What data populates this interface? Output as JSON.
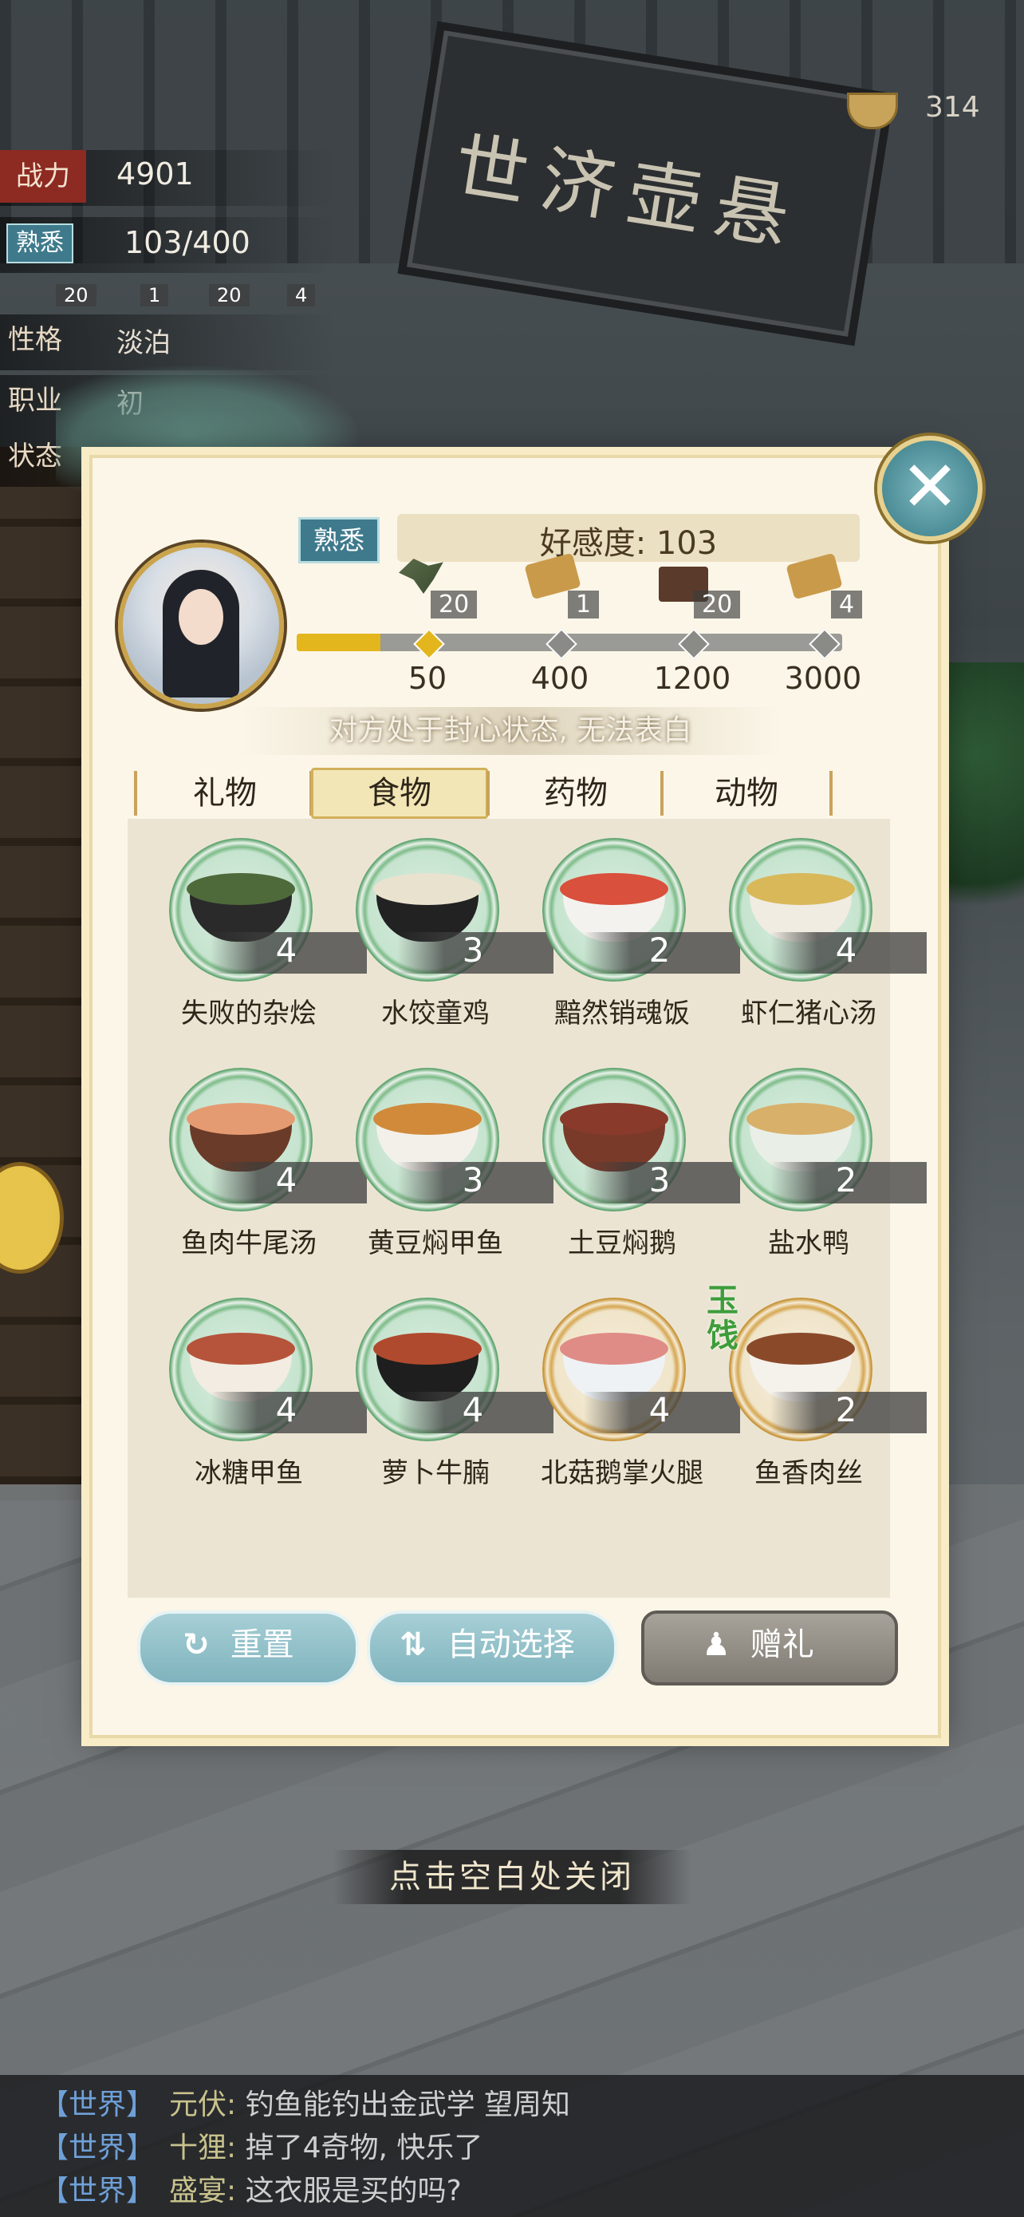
{
  "scene": {
    "signboard_text": "世济壶悬"
  },
  "currency": {
    "icon": "bowl-icon",
    "value": "314"
  },
  "stats": {
    "power_label": "战力",
    "power_value": "4901",
    "familiar_label": "熟悉",
    "familiar_value": "103/400",
    "rewards": [
      "20",
      "1",
      "20",
      "4"
    ],
    "personality_label": "性格",
    "personality_value": "淡泊",
    "job_label": "职业",
    "job_value": "初",
    "status_label": "状态"
  },
  "dialog": {
    "familiar_tag": "熟悉",
    "affinity_label": "好感度: 103",
    "affinity_progress": 0.153,
    "rewards": [
      {
        "icon": "herb-icon",
        "count": "20"
      },
      {
        "icon": "scroll-icon",
        "count": "1"
      },
      {
        "icon": "gem-chest-icon",
        "count": "20"
      },
      {
        "icon": "scroll-icon",
        "count": "4"
      }
    ],
    "milestones": [
      "50",
      "400",
      "1200",
      "3000"
    ],
    "closed_heart_text": "对方处于封心状态, 无法表白",
    "tabs": [
      "礼物",
      "食物",
      "药物",
      "动物"
    ],
    "active_tab": "食物",
    "items": [
      {
        "name": "失败的杂烩",
        "qty": "4",
        "bowl": "#2a2a2a",
        "food": "#4f6a3a",
        "ring": "green"
      },
      {
        "name": "水饺童鸡",
        "qty": "3",
        "bowl": "#222222",
        "food": "#e9e2cf",
        "ring": "green"
      },
      {
        "name": "黯然销魂饭",
        "qty": "2",
        "bowl": "#f4f2ee",
        "food": "#d9503c",
        "ring": "green"
      },
      {
        "name": "虾仁猪心汤",
        "qty": "4",
        "bowl": "#f0ece2",
        "food": "#d9b85a",
        "ring": "green"
      },
      {
        "name": "鱼肉牛尾汤",
        "qty": "4",
        "bowl": "#6a3b28",
        "food": "#e59b72",
        "ring": "green"
      },
      {
        "name": "黄豆焖甲鱼",
        "qty": "3",
        "bowl": "#f3f0ea",
        "food": "#d08a3a",
        "ring": "green"
      },
      {
        "name": "土豆焖鹅",
        "qty": "3",
        "bowl": "#7a3a2a",
        "food": "#8a3a2a",
        "ring": "green"
      },
      {
        "name": "盐水鸭",
        "qty": "2",
        "bowl": "#e9efe6",
        "food": "#d8b06a",
        "ring": "green"
      },
      {
        "name": "冰糖甲鱼",
        "qty": "4",
        "bowl": "#f2ece2",
        "food": "#b5543a",
        "ring": "green"
      },
      {
        "name": "萝卜牛腩",
        "qty": "4",
        "bowl": "#1e1e1e",
        "food": "#b04a2e",
        "ring": "green"
      },
      {
        "name": "北菇鹅掌火腿",
        "qty": "4",
        "bowl": "#eef2f4",
        "food": "#e08c86",
        "ring": "gold"
      },
      {
        "name": "鱼香肉丝",
        "qty": "2",
        "bowl": "#f5f2ec",
        "food": "#8a4a2a",
        "ring": "gold",
        "tag": "玉饯"
      }
    ],
    "buttons": {
      "reset": "重置",
      "auto_select": "自动选择",
      "gift": "赠礼"
    }
  },
  "hint": "点击空白处关闭",
  "chat": [
    {
      "channel": "【世界】",
      "user": "元伏:",
      "text": "钓鱼能钓出金武学 望周知"
    },
    {
      "channel": "【世界】",
      "user": "十狸:",
      "text": "掉了4奇物, 快乐了"
    },
    {
      "channel": "【世界】",
      "user": "盛宴:",
      "text": "这衣服是买的吗?"
    }
  ]
}
